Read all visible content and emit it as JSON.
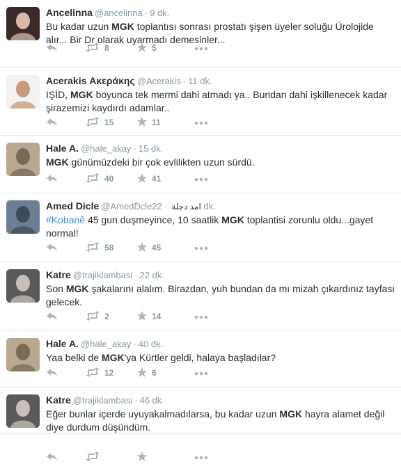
{
  "tweets": [
    {
      "fullname": "Ancelinna",
      "screenname": "@ancelinna",
      "time": "9 dk.",
      "text_parts": [
        [
          "Bu kadar uzun ",
          false
        ],
        [
          "MGK",
          true
        ],
        [
          " toplantısı sonrası prostatı şişen üyeler soluğu Ürolojide alır... Bir Dr olarak uyarmadı demesinler...",
          false
        ]
      ],
      "retweets": "8",
      "favorites": "5",
      "avatar_colors": [
        "#3a2b2a",
        "#d9b8a8"
      ]
    },
    {
      "fullname": "Acerakis Ακεράκης",
      "screenname": "@Acerakis",
      "time": "11 dk.",
      "text_parts": [
        [
          "IŞİD, ",
          false
        ],
        [
          "MGK",
          true
        ],
        [
          " boyunca tek mermi dahi atmadı ya.. Bundan dahi işkillenecek kadar şirazemizi kaydırdı adamlar..",
          false
        ]
      ],
      "retweets": "15",
      "favorites": "11",
      "avatar_colors": [
        "#f2f2f2",
        "#c89a7a"
      ]
    },
    {
      "fullname": "Hale A.",
      "screenname": "@hale_akay",
      "time": "15 dk.",
      "text_parts": [
        [
          "MGK",
          true
        ],
        [
          " günümüzdeki bir çok evlilikten uzun sürdü.",
          false
        ]
      ],
      "retweets": "40",
      "favorites": "41",
      "avatar_colors": [
        "#b8a890",
        "#7a6a55"
      ]
    },
    {
      "fullname": "Amed Dicle",
      "screenname": "@AmedDcle",
      "screenname_extra": "امد دجلة",
      "time": "22 dk.",
      "text_parts": [
        [
          "#Kobanê",
          "hashtag"
        ],
        [
          " 45 gun duşmeyince, 10 saatlik ",
          false
        ],
        [
          "MGK",
          true
        ],
        [
          " toplantisi zorunlu oldu...gayet normal!",
          false
        ]
      ],
      "retweets": "58",
      "favorites": "45",
      "avatar_colors": [
        "#6a7f95",
        "#3c4b5a"
      ]
    },
    {
      "fullname": "Katre",
      "screenname": "@trajiklambasi",
      "time": "22 dk.",
      "text_parts": [
        [
          "Son ",
          false
        ],
        [
          "MGK",
          true
        ],
        [
          " şakalarını alalım. Birazdan, yuh bundan da mı mizah çıkardınız tayfası gelecek.",
          false
        ]
      ],
      "retweets": "2",
      "favorites": "14",
      "avatar_colors": [
        "#5a5a5a",
        "#c8c0b8"
      ]
    },
    {
      "fullname": "Hale A.",
      "screenname": "@hale_akay",
      "time": "40 dk.",
      "text_parts": [
        [
          "Yaa belki de ",
          false
        ],
        [
          "MGK",
          true
        ],
        [
          "'ya Kürtler geldi, halaya başladılar?",
          false
        ]
      ],
      "retweets": "12",
      "favorites": "6",
      "avatar_colors": [
        "#b8a890",
        "#7a6a55"
      ]
    },
    {
      "fullname": "Katre",
      "screenname": "@trajiklambasi",
      "time": "46 dk.",
      "text_parts": [
        [
          "Eğer bunlar içerde uyuyakalmadılarsa, bu kadar uzun ",
          false
        ],
        [
          "MGK",
          true
        ],
        [
          " hayra alamet değil diye durdum düşündüm.",
          false
        ]
      ],
      "retweets": "",
      "favorites": "",
      "avatar_colors": [
        "#5a5a5a",
        "#c8c0b8"
      ]
    }
  ],
  "colors": {
    "icon": "#aab8c2",
    "meta": "#8899a6",
    "text": "#292f33",
    "link": "#3b94d9",
    "divider": "#e1e8ed"
  },
  "icons": {
    "reply": "reply-icon",
    "retweet": "retweet-icon",
    "favorite": "star-icon",
    "more": "more-icon"
  }
}
